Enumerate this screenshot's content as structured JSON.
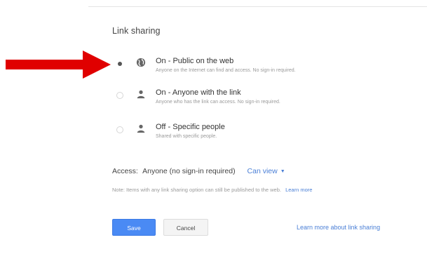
{
  "dialog": {
    "heading": "Link sharing",
    "options": [
      {
        "title": "On - Public on the web",
        "description": "Anyone on the Internet can find and access. No sign-in required.",
        "icon": "globe-icon",
        "selected": true
      },
      {
        "title": "On - Anyone with the link",
        "description": "Anyone who has the link can access. No sign-in required.",
        "icon": "link-person-icon",
        "selected": false
      },
      {
        "title": "Off - Specific people",
        "description": "Shared with specific people.",
        "icon": "person-icon",
        "selected": false
      }
    ],
    "access": {
      "label": "Access:",
      "value": "Anyone (no sign-in required)",
      "permission": "Can view"
    },
    "note": {
      "text": "Note: Items with any link sharing option can still be published to the web.",
      "link": "Learn more"
    },
    "buttons": {
      "save": "Save",
      "cancel": "Cancel"
    },
    "learn_more_link": "Learn more about link sharing"
  },
  "annotation": {
    "arrow_color": "#e00000"
  },
  "colors": {
    "accent": "#4a8af4",
    "link": "#4a7fd6"
  }
}
